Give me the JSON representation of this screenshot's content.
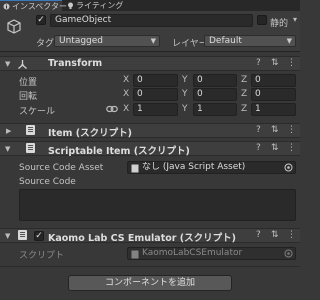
{
  "tabs": [
    {
      "label": "インスペクター",
      "icon": "info-icon",
      "active": true
    },
    {
      "label": "ライティング",
      "icon": "bulb-icon",
      "active": false
    }
  ],
  "header": {
    "object_name": "GameObject",
    "active": true,
    "static_label": "静的",
    "tag_label": "タグ",
    "tag_value": "Untagged",
    "layer_label": "レイヤー",
    "layer_value": "Default"
  },
  "transform": {
    "title": "Transform",
    "rows": [
      {
        "label": "位置",
        "x": "0",
        "y": "0",
        "z": "0"
      },
      {
        "label": "回転",
        "x": "0",
        "y": "0",
        "z": "0"
      },
      {
        "label": "スケール",
        "x": "1",
        "y": "1",
        "z": "1"
      }
    ],
    "axes": [
      "X",
      "Y",
      "Z"
    ]
  },
  "item": {
    "title": "Item (スクリプト)"
  },
  "scriptable_item": {
    "title": "Scriptable Item (スクリプト)",
    "source_asset_label": "Source Code Asset",
    "source_asset_value": "なし (Java Script Asset)",
    "source_code_label": "Source Code"
  },
  "emulator": {
    "title": "Kaomo Lab CS Emulator (スクリプト)",
    "enabled": true,
    "script_label": "スクリプト",
    "script_value": "KaomoLabCSEmulator"
  },
  "add_component_label": "コンポーネントを追加",
  "colors": {
    "background": "#383838",
    "accent": "#3a79bb",
    "field": "#2a2a2a"
  }
}
